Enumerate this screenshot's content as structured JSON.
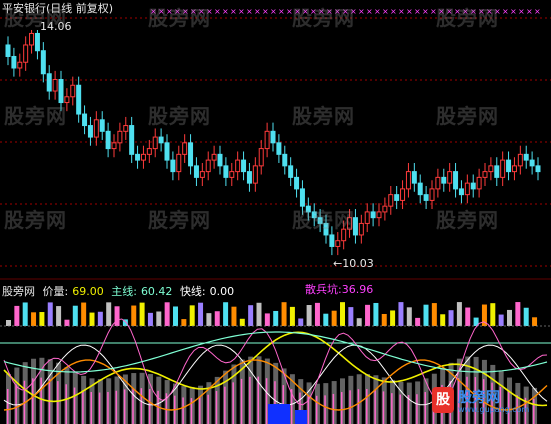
{
  "title": "平安银行(日线 前复权)",
  "watermark_text": "股旁网",
  "price_high_label": "14.06",
  "price_low_label": "←10.03",
  "indicator": {
    "name": "股旁网",
    "price_label": "价量:",
    "price_value": "69.00",
    "main_label": "主线:",
    "main_value": "60.42",
    "fast_label": "快线:",
    "fast_value": "0.00",
    "retail_label": "散兵坑:",
    "retail_value": "36.96"
  },
  "logo": {
    "mark": "股",
    "name": "股旁网",
    "url": "www.gupang.com"
  },
  "colors": {
    "up": "#ff3b3b",
    "down": "#4fe0f0",
    "grid": "#a00000",
    "marker": "#ff40ff",
    "main_line": "#7fffd4",
    "fast_line": "#ffffff",
    "yellow_line": "#f0f000",
    "orange_line": "#ff8c00",
    "pink_line": "#ff66cc"
  },
  "chart_data": {
    "type": "candlestick",
    "price_high": 14.06,
    "price_low": 10.03,
    "candles_close": [
      13.6,
      13.4,
      13.5,
      13.8,
      14.0,
      13.7,
      13.3,
      13.0,
      13.2,
      12.8,
      12.9,
      13.1,
      12.6,
      12.4,
      12.2,
      12.5,
      12.3,
      12.0,
      12.1,
      12.3,
      12.4,
      11.9,
      11.8,
      11.9,
      12.0,
      12.2,
      12.1,
      11.8,
      11.6,
      11.9,
      12.1,
      11.7,
      11.5,
      11.6,
      11.8,
      11.9,
      11.7,
      11.5,
      11.6,
      11.8,
      11.6,
      11.4,
      11.7,
      12.0,
      12.3,
      12.1,
      11.9,
      11.7,
      11.5,
      11.3,
      11.0,
      10.9,
      10.8,
      10.7,
      10.5,
      10.3,
      10.4,
      10.6,
      10.8,
      10.5,
      10.7,
      10.9,
      10.8,
      10.9,
      11.0,
      11.2,
      11.1,
      11.3,
      11.6,
      11.4,
      11.2,
      11.1,
      11.3,
      11.5,
      11.4,
      11.6,
      11.3,
      11.2,
      11.4,
      11.3,
      11.5,
      11.6,
      11.7,
      11.5,
      11.8,
      11.6,
      11.7,
      11.9,
      11.8,
      11.7,
      11.6
    ],
    "indicator_values": {
      "price_volume": 69.0,
      "main_line": 60.42,
      "fast_line": 0.0,
      "retail_pit": 36.96
    }
  }
}
